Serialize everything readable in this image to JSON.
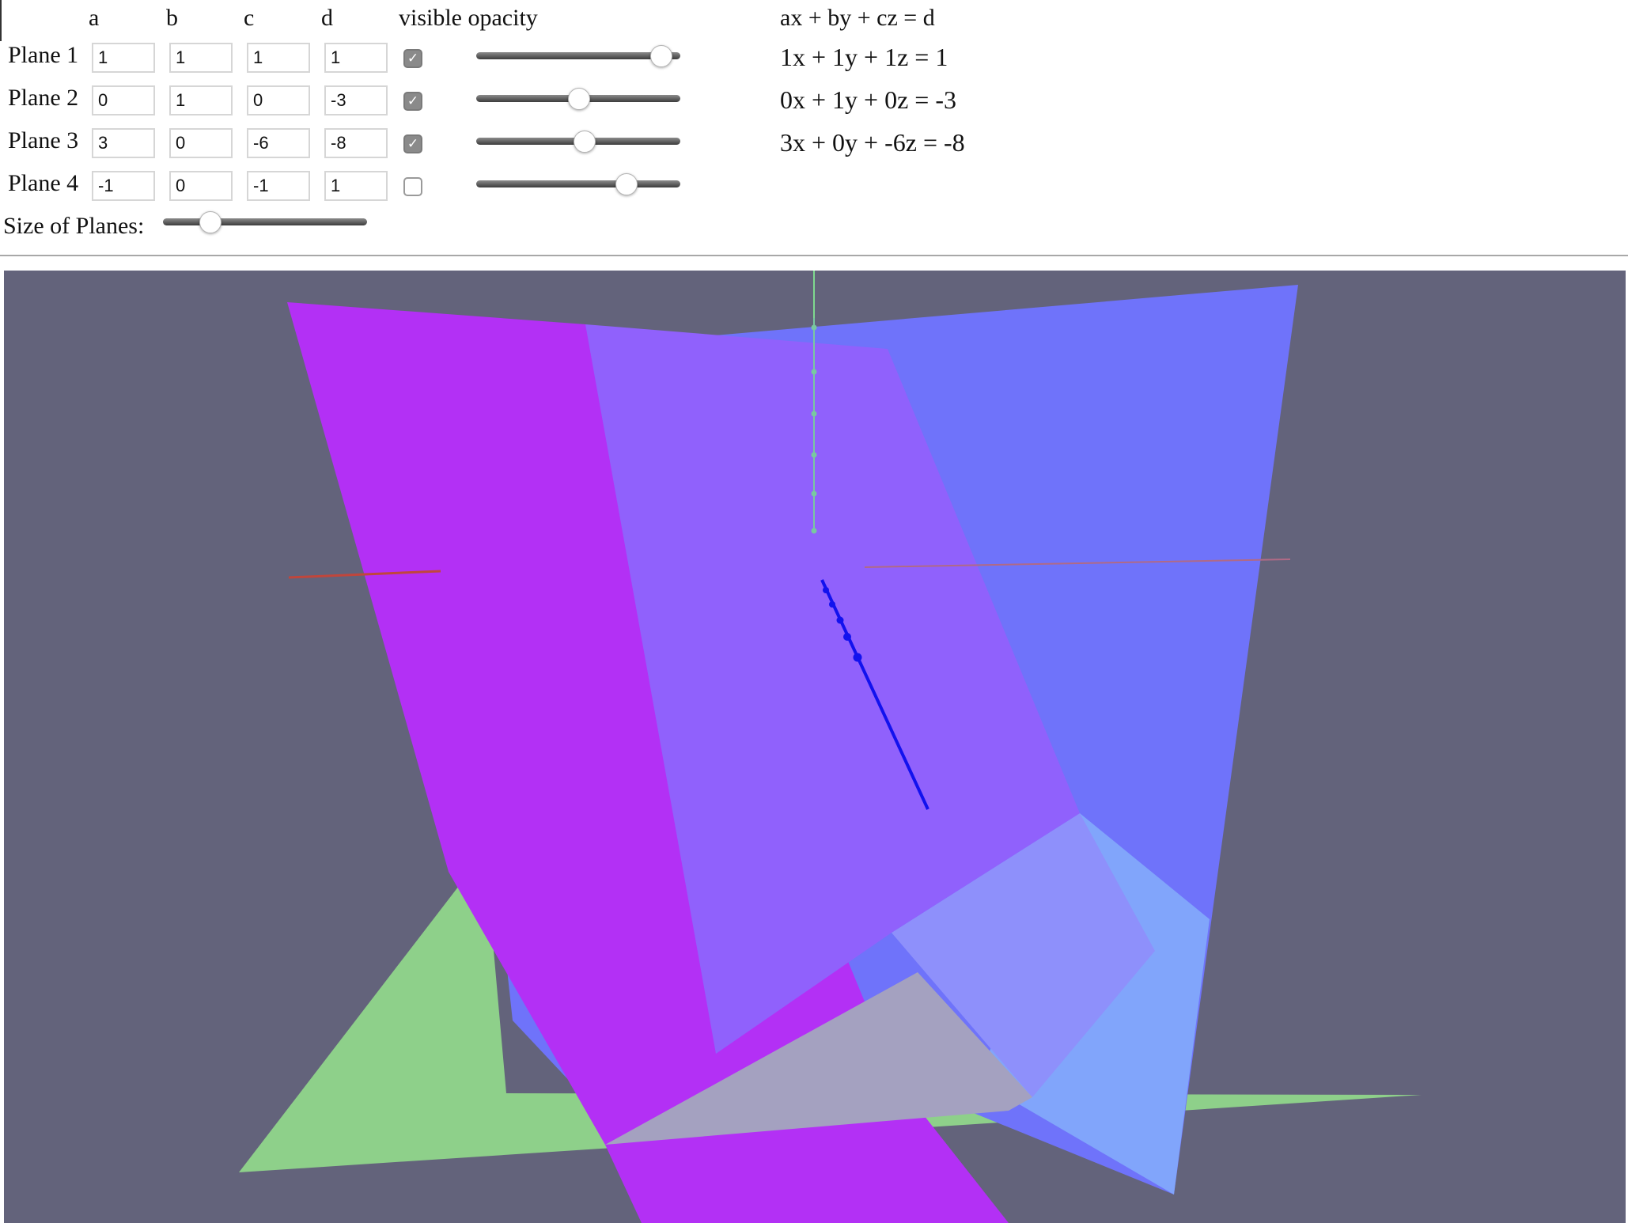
{
  "columns": {
    "a": "a",
    "b": "b",
    "c": "c",
    "d": "d",
    "visible_opacity": "visible opacity",
    "equation_form": "ax + by + cz = d"
  },
  "planes": [
    {
      "label": "Plane 1",
      "a": "1",
      "b": "1",
      "c": "1",
      "d": "1",
      "visible": true,
      "opacity": 0.95,
      "equation": "1x + 1y + 1z = 1"
    },
    {
      "label": "Plane 2",
      "a": "0",
      "b": "1",
      "c": "0",
      "d": "-3",
      "visible": true,
      "opacity": 0.5,
      "equation": "0x + 1y + 0z = -3"
    },
    {
      "label": "Plane 3",
      "a": "3",
      "b": "0",
      "c": "-6",
      "d": "-8",
      "visible": true,
      "opacity": 0.53,
      "equation": "3x + 0y + -6z = -8"
    },
    {
      "label": "Plane 4",
      "a": "-1",
      "b": "0",
      "c": "-1",
      "d": "1",
      "visible": false,
      "opacity": 0.76,
      "equation": ""
    }
  ],
  "size_of_planes": {
    "label": "Size of Planes:",
    "value": 0.2
  },
  "scene": {
    "background": "#63637b",
    "colors": {
      "magenta_plane": "#b330f5",
      "blue_plane": "#6f73fa",
      "green_plane": "#8ed08a",
      "x_axis": "#c0463c",
      "y_axis": "#7fd98f",
      "intersection_line": "#1212ee"
    }
  }
}
